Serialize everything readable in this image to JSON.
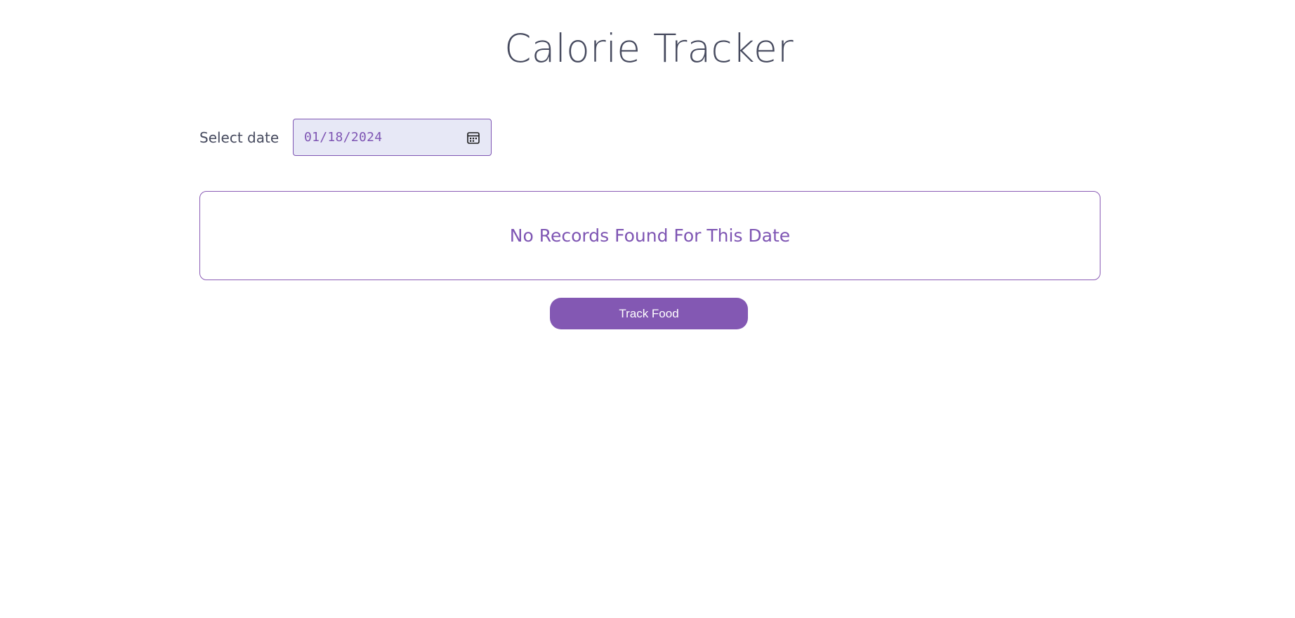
{
  "header": {
    "title": "Calorie Tracker"
  },
  "date_picker": {
    "label": "Select date",
    "value": "01/18/2024",
    "icon": "calendar-icon"
  },
  "records": {
    "empty_message": "No Records Found For This Date"
  },
  "actions": {
    "track_food_label": "Track Food"
  },
  "colors": {
    "accent": "#8358b3",
    "text": "#464a5e",
    "input_bg": "#e7e8f6"
  }
}
